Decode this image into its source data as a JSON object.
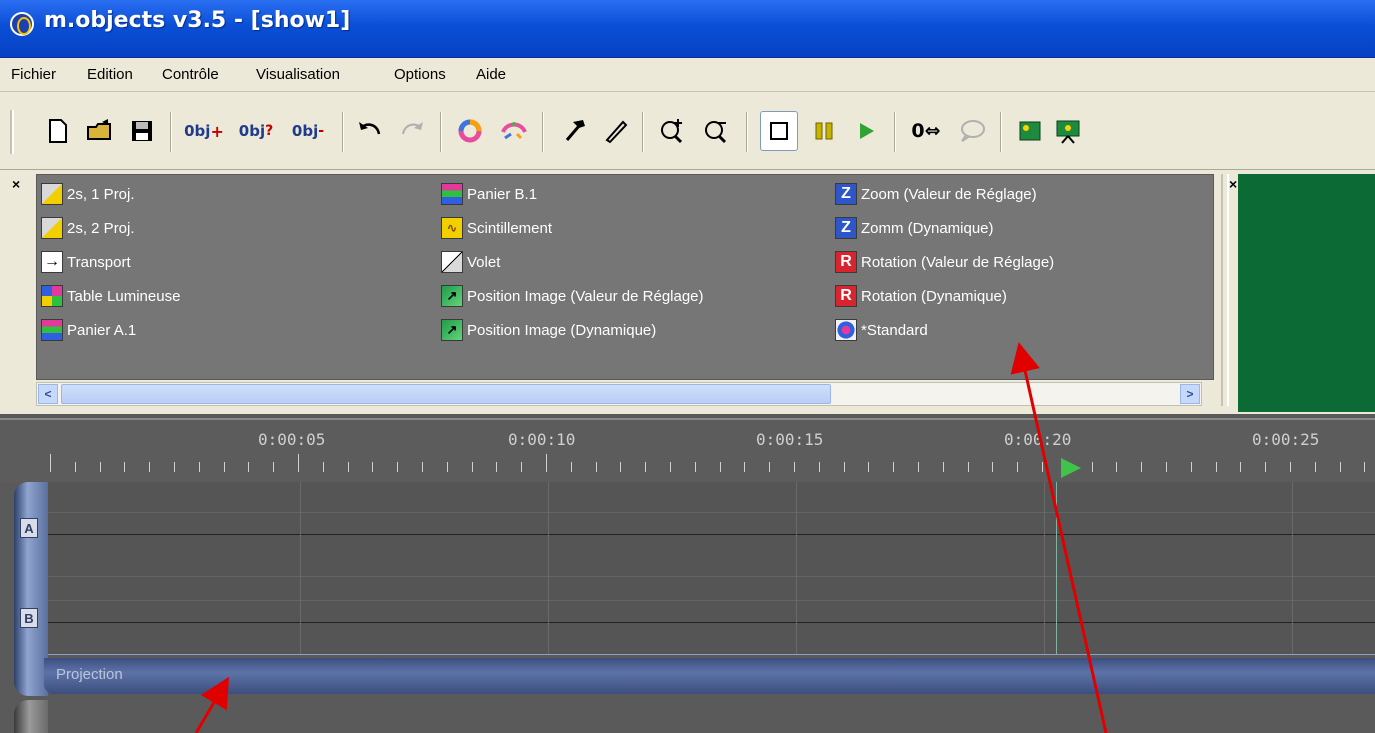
{
  "window": {
    "title": "m.objects v3.5 - [show1]"
  },
  "menubar": {
    "items": [
      {
        "label": "Fichier"
      },
      {
        "label": "Edition"
      },
      {
        "label": "Contrôle"
      },
      {
        "label": "Visualisation"
      },
      {
        "label": "Options"
      },
      {
        "label": "Aide"
      }
    ]
  },
  "toolbar": {
    "buttons": [
      {
        "name": "new-icon"
      },
      {
        "name": "open-folder-icon"
      },
      {
        "name": "save-icon"
      },
      {
        "name": "object-add-icon",
        "label": "0bj"
      },
      {
        "name": "object-query-icon",
        "label": "0bj"
      },
      {
        "name": "object-remove-icon",
        "label": "0bj"
      },
      {
        "name": "undo-icon"
      },
      {
        "name": "redo-icon"
      },
      {
        "name": "color-wheel-icon"
      },
      {
        "name": "color-sparkle-icon"
      },
      {
        "name": "hammer-icon"
      },
      {
        "name": "pen-icon"
      },
      {
        "name": "zoom-in-icon"
      },
      {
        "name": "zoom-out-icon"
      },
      {
        "name": "stop-icon"
      },
      {
        "name": "pause-icon"
      },
      {
        "name": "play-icon"
      },
      {
        "name": "counter-reset-icon",
        "label": "0⇔"
      },
      {
        "name": "speech-bubble-icon"
      },
      {
        "name": "image-icon"
      },
      {
        "name": "presentation-icon"
      }
    ],
    "colors": {
      "accent": "#0a4fd6",
      "play": "#2fa336",
      "pause": "#c8b400"
    }
  },
  "effects_panel": {
    "columns": [
      [
        {
          "label": "2s, 1 Proj.",
          "icon": "fade-icon"
        },
        {
          "label": "2s, 2 Proj.",
          "icon": "fade-icon"
        },
        {
          "label": "Transport",
          "icon": "arrow-right-icon"
        },
        {
          "label": "Table Lumineuse",
          "icon": "lightbox-icon"
        },
        {
          "label": "Panier A.1",
          "icon": "magazine-icon"
        }
      ],
      [
        {
          "label": "Panier B.1",
          "icon": "magazine-icon"
        },
        {
          "label": "Scintillement",
          "icon": "flicker-icon"
        },
        {
          "label": "Volet",
          "icon": "wipe-icon"
        },
        {
          "label": "Position Image (Valeur de Réglage)",
          "icon": "image-position-icon"
        },
        {
          "label": "Position Image (Dynamique)",
          "icon": "image-position-icon"
        }
      ],
      [
        {
          "label": "Zoom (Valeur de Réglage)",
          "icon": "zoom-z-icon",
          "glyph": "Z"
        },
        {
          "label": "Zomm (Dynamique)",
          "icon": "zoom-z-icon",
          "glyph": "Z"
        },
        {
          "label": "Rotation (Valeur de Réglage)",
          "icon": "rotation-r-icon",
          "glyph": "R"
        },
        {
          "label": "Rotation (Dynamique)",
          "icon": "rotation-r-icon",
          "glyph": "R"
        },
        {
          "label": "*Standard",
          "icon": "standard-icon"
        }
      ]
    ],
    "preview_color": "#0c6a35"
  },
  "timeline": {
    "ruler_labels": [
      "0:00:05",
      "0:00:10",
      "0:00:15",
      "0:00:20",
      "0:00:25"
    ],
    "tracks": [
      {
        "tag": "A"
      },
      {
        "tag": "B"
      }
    ],
    "group_label": "Projection"
  },
  "annotation": {
    "arrow_color": "#e00000"
  }
}
